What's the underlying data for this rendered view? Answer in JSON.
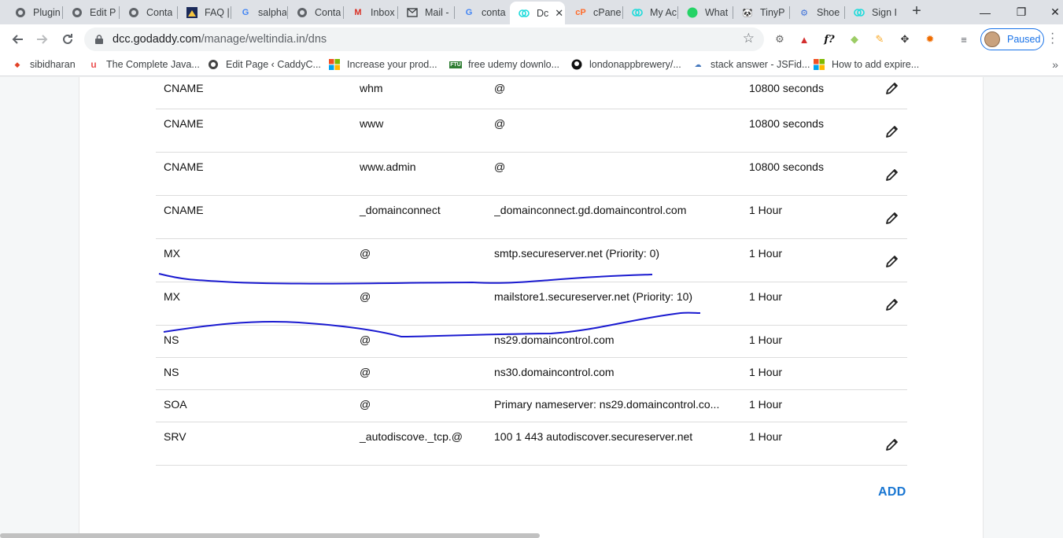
{
  "browser": {
    "tabs": [
      {
        "label": "Plugin",
        "icon": "globe-icon"
      },
      {
        "label": "Edit P",
        "icon": "globe-icon"
      },
      {
        "label": "Conta",
        "icon": "globe-icon"
      },
      {
        "label": "FAQ |",
        "icon": "site-icon"
      },
      {
        "label": "salpha",
        "icon": "google-icon"
      },
      {
        "label": "Conta",
        "icon": "globe-icon"
      },
      {
        "label": "Inbox",
        "icon": "gmail-icon"
      },
      {
        "label": "Mail -",
        "icon": "mail-icon"
      },
      {
        "label": "conta",
        "icon": "google-icon"
      },
      {
        "label": "Dc",
        "icon": "godaddy-icon",
        "active": true
      },
      {
        "label": "cPane",
        "icon": "cpanel-icon"
      },
      {
        "label": "My Ac",
        "icon": "godaddy-icon"
      },
      {
        "label": "What",
        "icon": "whatsapp-icon"
      },
      {
        "label": "TinyP",
        "icon": "tinypng-icon"
      },
      {
        "label": "Shoe",
        "icon": "gear-icon"
      },
      {
        "label": "Sign I",
        "icon": "godaddy-icon"
      }
    ],
    "new_tab": "+",
    "window": {
      "minimize": "—",
      "restore": "❐",
      "close": "✕"
    },
    "address": {
      "host": "dcc.godaddy.com",
      "path": "/manage/weltindia.in/dns"
    },
    "profile_status": "Paused",
    "bookmarks": [
      {
        "label": "sibidharan",
        "icon": "gitlab-icon"
      },
      {
        "label": "The Complete Java...",
        "icon": "udemy-icon"
      },
      {
        "label": "Edit Page ‹ CaddyC...",
        "icon": "globe-icon"
      },
      {
        "label": "Increase your prod...",
        "icon": "microsoft-icon"
      },
      {
        "label": "free udemy downlo...",
        "icon": "ftu-icon"
      },
      {
        "label": "londonappbrewery/...",
        "icon": "github-icon"
      },
      {
        "label": "stack answer - JSFid...",
        "icon": "jsfiddle-icon"
      },
      {
        "label": "How to add expire...",
        "icon": "microsoft-icon"
      }
    ]
  },
  "dns": {
    "records": [
      {
        "type": "CNAME",
        "name": "whm",
        "value": "@",
        "ttl": "10800 seconds",
        "editable": true
      },
      {
        "type": "CNAME",
        "name": "www",
        "value": "@",
        "ttl": "10800 seconds",
        "editable": true
      },
      {
        "type": "CNAME",
        "name": "www.admin",
        "value": "@",
        "ttl": "10800 seconds",
        "editable": true
      },
      {
        "type": "CNAME",
        "name": "_domainconnect",
        "value": "_domainconnect.gd.domaincontrol.com",
        "ttl": "1 Hour",
        "editable": true
      },
      {
        "type": "MX",
        "name": "@",
        "value": "smtp.secureserver.net (Priority: 0)",
        "ttl": "1 Hour",
        "editable": true
      },
      {
        "type": "MX",
        "name": "@",
        "value": "mailstore1.secureserver.net (Priority: 10)",
        "ttl": "1 Hour",
        "editable": true
      },
      {
        "type": "NS",
        "name": "@",
        "value": "ns29.domaincontrol.com",
        "ttl": "1 Hour",
        "editable": false
      },
      {
        "type": "NS",
        "name": "@",
        "value": "ns30.domaincontrol.com",
        "ttl": "1 Hour",
        "editable": false
      },
      {
        "type": "SOA",
        "name": "@",
        "value": "Primary nameserver: ns29.domaincontrol.co...",
        "ttl": "1 Hour",
        "editable": false
      },
      {
        "type": "SRV",
        "name": "_autodiscove._tcp.@",
        "value": "100 1 443 autodiscover.secureserver.net",
        "ttl": "1 Hour",
        "editable": true
      }
    ],
    "add_label": "ADD"
  },
  "colors": {
    "accent": "#1976d2",
    "annotation_ink": "#1a1ad0"
  }
}
